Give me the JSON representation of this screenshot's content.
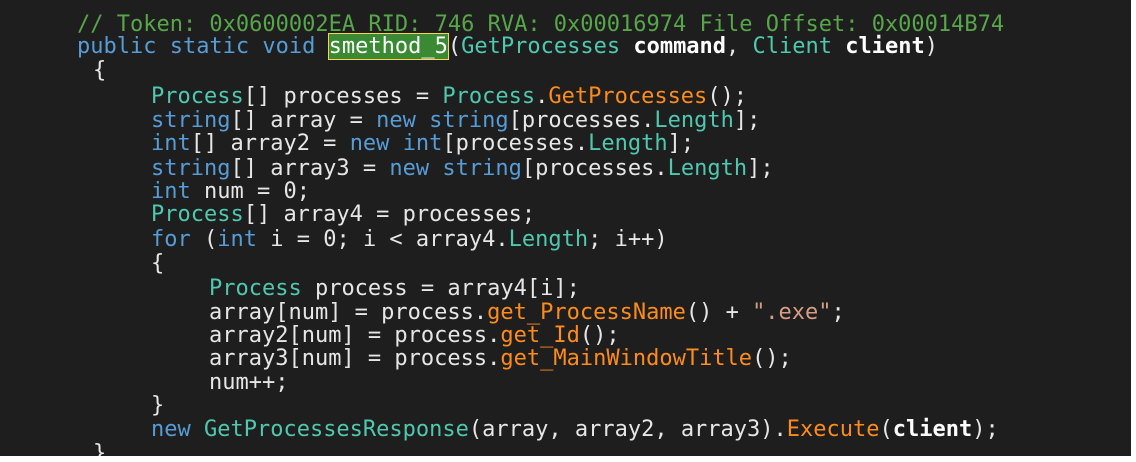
{
  "code": {
    "comment": "// Token: 0x0600002EA RID: 746 RVA: 0x00016974 File Offset: 0x00014B74",
    "sig": {
      "kw": "public static void ",
      "method": "smethod_5",
      "open": "(",
      "type": "GetProcesses",
      "param1": "command",
      "comma": ", ",
      "type2": "Client",
      "param2": "client",
      "close": ")"
    },
    "l_open": "{",
    "l1": {
      "t1": "Process",
      "a": "[] processes = ",
      "t2": "Process",
      "dot": ".",
      "m": "GetProcesses",
      "end": "();"
    },
    "l2": {
      "k1": "string",
      "a": "[] array = ",
      "k2": "new",
      "sp": " ",
      "k3": "string",
      "b": "[processes.",
      "m": "Length",
      "end": "];"
    },
    "l3": {
      "k1": "int",
      "a": "[] array2 = ",
      "k2": "new",
      "sp": " ",
      "k3": "int",
      "b": "[processes.",
      "m": "Length",
      "end": "];"
    },
    "l4": {
      "k1": "string",
      "a": "[] array3 = ",
      "k2": "new",
      "sp": " ",
      "k3": "string",
      "b": "[processes.",
      "m": "Length",
      "end": "];"
    },
    "l5": {
      "k1": "int",
      "a": " num = 0;"
    },
    "l6": {
      "t1": "Process",
      "a": "[] array4 = processes;"
    },
    "l7": {
      "k1": "for",
      "a": " (",
      "k2": "int",
      "b": " i = 0; i < array4.",
      "m": "Length",
      "end": "; i++)"
    },
    "l_open2": "{",
    "l8": {
      "t1": "Process",
      "a": " process = array4[i];"
    },
    "l9": {
      "a": "array[num] = process.",
      "m": "get_ProcessName",
      "b": "() + ",
      "s": "\".exe\"",
      "end": ";"
    },
    "l10": {
      "a": "array2[num] = process.",
      "m": "get_Id",
      "end": "();"
    },
    "l11": {
      "a": "array3[num] = process.",
      "m": "get_MainWindowTitle",
      "end": "();"
    },
    "l12": "num++;",
    "l_close2": "}",
    "l13": {
      "k1": "new",
      "sp": " ",
      "t1": "GetProcessesResponse",
      "a": "(array, array2, array3).",
      "m": "Execute",
      "b": "(",
      "p": "client",
      "end": ");"
    },
    "l_close": "}"
  },
  "colors": {
    "background": "#1e1e1e",
    "keyword": "#569cd6",
    "type": "#4ec9b0",
    "method": "#ff8c1a",
    "string": "#d69d85",
    "highlight": "#3a8a34"
  }
}
